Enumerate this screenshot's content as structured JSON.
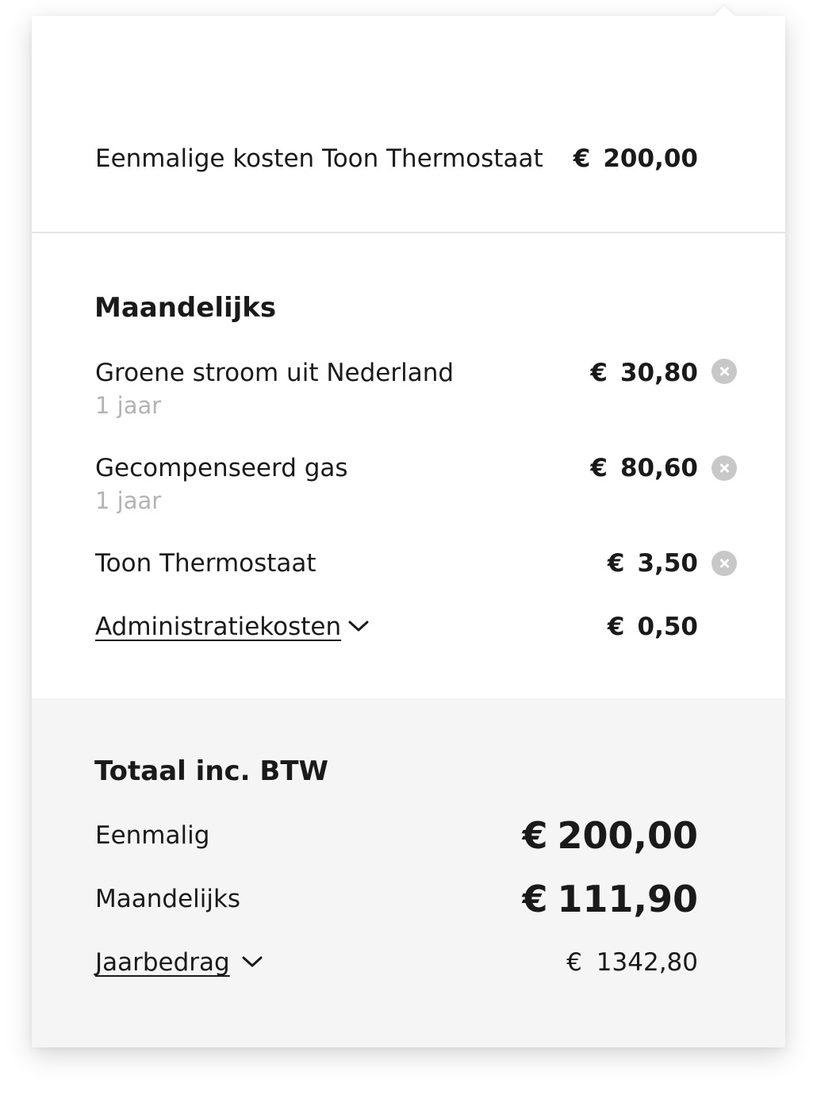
{
  "one_time": {
    "label": "Eenmalige kosten Toon Thermostaat",
    "currency": "€",
    "amount": "200,00"
  },
  "monthly": {
    "heading": "Maandelijks",
    "items": [
      {
        "label": "Groene stroom uit Nederland",
        "sub": "1 jaar",
        "currency": "€",
        "amount": "30,80",
        "remove_icon": "close-circle-icon"
      },
      {
        "label": "Gecompenseerd gas",
        "sub": "1 jaar",
        "currency": "€",
        "amount": "80,60",
        "remove_icon": "close-circle-icon"
      },
      {
        "label": "Toon Thermostaat",
        "currency": "€",
        "amount": "3,50",
        "remove_icon": "close-circle-icon"
      }
    ],
    "admin": {
      "label": "Administratiekosten",
      "icon": "chevron-down-icon",
      "currency": "€",
      "amount": "0,50"
    }
  },
  "totals": {
    "heading": "Totaal inc. BTW",
    "one_time": {
      "label": "Eenmalig",
      "currency": "€",
      "amount": "200,00"
    },
    "monthly": {
      "label": "Maandelijks",
      "currency": "€",
      "amount": "111,90"
    },
    "yearly": {
      "label": "Jaarbedrag",
      "icon": "chevron-down-icon",
      "currency": "€",
      "amount": "1342,80"
    }
  },
  "colors": {
    "text": "#1a1a1a",
    "muted": "#b3b3b3",
    "totals_background": "#f5f5f5",
    "divider": "#e5e5e5",
    "remove_icon": "#c8c8c8"
  }
}
